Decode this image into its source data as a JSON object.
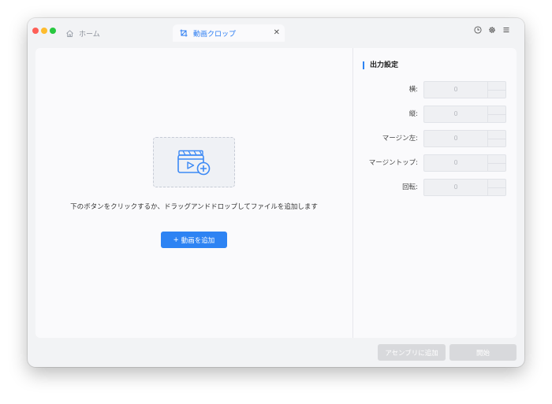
{
  "tabs": {
    "home_label": "ホーム",
    "active_label": "動画クロップ",
    "close_glyph": "✕"
  },
  "toolbar": {
    "icons": [
      "history-icon",
      "settings-icon",
      "menu-icon"
    ]
  },
  "drop_area": {
    "hint": "下のボタンをクリックするか、ドラッグアンドドロップしてファイルを追加します",
    "add_button_label": "動画を追加",
    "add_button_plus": "+"
  },
  "settings": {
    "title": "出力設定",
    "fields": [
      {
        "label": "横:",
        "value": "0"
      },
      {
        "label": "縦:",
        "value": "0"
      },
      {
        "label": "マージン左:",
        "value": "0"
      },
      {
        "label": "マージントップ:",
        "value": "0"
      },
      {
        "label": "回転:",
        "value": "0"
      }
    ]
  },
  "footer": {
    "enqueue_label": "アセンブリに追加",
    "start_label": "開始"
  },
  "colors": {
    "accent": "#2d83f3",
    "disabled_button": "#d8d9dc",
    "close_red": "#fe5f57",
    "minimize_yellow": "#febc2e",
    "zoom_green": "#28c840"
  }
}
